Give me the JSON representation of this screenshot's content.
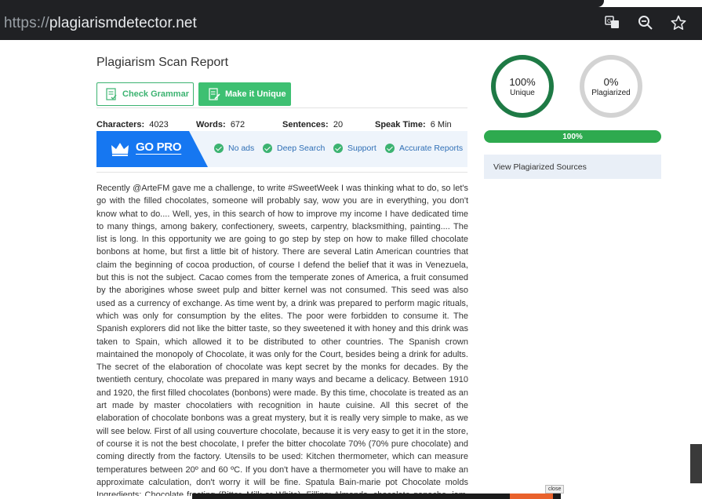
{
  "browser": {
    "url_scheme": "https://",
    "url_host": "plagiarismdetector.net"
  },
  "report": {
    "title": "Plagiarism Scan Report",
    "check_grammar_label": "Check Grammar",
    "make_unique_label": "Make it Unique"
  },
  "stats": {
    "characters_label": "Characters:",
    "characters_value": "4023",
    "words_label": "Words:",
    "words_value": "672",
    "sentences_label": "Sentences:",
    "sentences_value": "20",
    "speak_label": "Speak Time:",
    "speak_value": "6 Min"
  },
  "gopro": {
    "label": "GO PRO",
    "features": [
      "No ads",
      "Deep Search",
      "Support",
      "Accurate Reports"
    ]
  },
  "body_text": "Recently @ArteFM gave me a challenge, to write #SweetWeek I was thinking what to do, so let's go with the filled chocolates, someone will probably say, wow you are in everything, you don't know what to do.... Well, yes, in this search of how to improve my income I have dedicated time to many things, among bakery, confectionery, sweets, carpentry, blacksmithing, painting.... The list is long. In this opportunity we are going to go step by step on how to make filled chocolate bonbons at home, but first a little bit of history. There are several Latin American countries that claim the beginning of cocoa production, of course I defend the belief that it was in Venezuela, but this is not the subject. Cacao comes from the temperate zones of America, a fruit consumed by the aborigines whose sweet pulp and bitter kernel was not consumed. This seed was also used as a currency of exchange. As time went by, a drink was prepared to perform magic rituals, which was only for consumption by the elites. The poor were forbidden to consume it. The Spanish explorers did not like the bitter taste, so they sweetened it with honey and this drink was taken to Spain, which allowed it to be distributed to other countries. The Spanish crown maintained the monopoly of Chocolate, it was only for the Court, besides being a drink for adults. The secret of the elaboration of chocolate was kept secret by the monks for decades. By the twentieth century, chocolate was prepared in many ways and became a delicacy. Between 1910 and 1920, the first filled chocolates (bonbons) were made. By this time, chocolate is treated as an art made by master chocolatiers with recognition in haute cuisine. All this secret of the elaboration of chocolate bonbons was a great mystery, but it is really very simple to make, as we will see below. First of all using couverture chocolate, because it is very easy to get it in the store, of course it is not the best chocolate, I prefer the bitter chocolate 70% (70% pure chocolate) and coming directly from the factory. Utensils to be used: Kitchen thermometer, which can measure temperatures between 20º and 60 ºC. If you don't have a thermometer you will have to make an approximate calculation, don't worry it will be fine. Spatula Bain-marie pot Chocolate molds Ingredients: Chocolate frosting (Bitter, Milk or White). Filling: Almonds, chocolate ganache, jam, peanut butter or whatever you want. The first thing to do is to chop the chocolate and melt it in a Bain Marie,",
  "result": {
    "unique_pct": "100%",
    "unique_label": "Unique",
    "plag_pct": "0%",
    "plag_label": "Plagiarized",
    "progress_label": "100%",
    "progress_fraction": 1.0,
    "sources_label": "View Plagiarized Sources"
  },
  "ad": {
    "close_label": "close"
  },
  "colors": {
    "accent_green": "#3ec072",
    "unique_ring": "#1e7a45",
    "gopro_blue": "#1677f1"
  },
  "icons": {
    "translate": "translate-icon",
    "zoom": "zoom-out-icon",
    "bookmark": "star-icon",
    "crown": "crown-icon",
    "check": "check-circle-icon"
  }
}
